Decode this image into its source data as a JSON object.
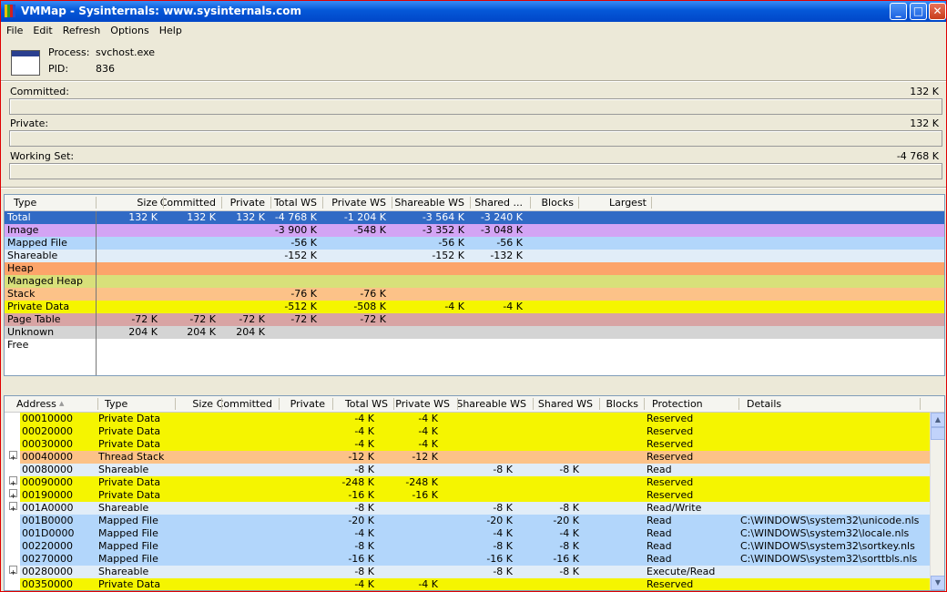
{
  "window": {
    "title": "VMMap - Sysinternals: www.sysinternals.com"
  },
  "icons": {
    "app": "vmmap-app-icon",
    "minimize": "minimize-icon",
    "maximize": "maximize-icon",
    "close": "close-icon",
    "process": "process-window-icon",
    "expand": "plus-expand-icon",
    "sort": "sort-ascending-icon"
  },
  "menu": [
    "File",
    "Edit",
    "Refresh",
    "Options",
    "Help"
  ],
  "process": {
    "process_label": "Process:",
    "process_value": "svchost.exe",
    "pid_label": "PID:",
    "pid_value": "836"
  },
  "meters": {
    "committed": {
      "label": "Committed:",
      "value": "132 K"
    },
    "private": {
      "label": "Private:",
      "value": "132 K"
    },
    "working_set": {
      "label": "Working Set:",
      "value": "-4 768 K"
    }
  },
  "summary": {
    "columns": [
      "Type",
      "Size",
      "Committed",
      "Private",
      "Total WS",
      "Private WS",
      "Shareable WS",
      "Shared ...",
      "Blocks",
      "Largest"
    ],
    "rows": [
      {
        "type": "Total",
        "size": "132 K",
        "committed": "132 K",
        "private": "132 K",
        "total_ws": "-4 768 K",
        "private_ws": "-1 204 K",
        "shareable_ws": "-3 564 K",
        "shared": "-3 240 K",
        "color": "#316ac5"
      },
      {
        "type": "Image",
        "size": "",
        "committed": "",
        "private": "",
        "total_ws": "-3 900 K",
        "private_ws": "-548 K",
        "shareable_ws": "-3 352 K",
        "shared": "-3 048 K",
        "color": "#d3a4f4"
      },
      {
        "type": "Mapped File",
        "size": "",
        "committed": "",
        "private": "",
        "total_ws": "-56 K",
        "private_ws": "",
        "shareable_ws": "-56 K",
        "shared": "-56 K",
        "color": "#b2d6fb"
      },
      {
        "type": "Shareable",
        "size": "",
        "committed": "",
        "private": "",
        "total_ws": "-152 K",
        "private_ws": "",
        "shareable_ws": "-152 K",
        "shared": "-132 K",
        "color": "#e1edf8"
      },
      {
        "type": "Heap",
        "size": "",
        "committed": "",
        "private": "",
        "total_ws": "",
        "private_ws": "",
        "shareable_ws": "",
        "shared": "",
        "color": "#fca46a"
      },
      {
        "type": "Managed Heap",
        "size": "",
        "committed": "",
        "private": "",
        "total_ws": "",
        "private_ws": "",
        "shareable_ws": "",
        "shared": "",
        "color": "#d8e07a"
      },
      {
        "type": "Stack",
        "size": "",
        "committed": "",
        "private": "",
        "total_ws": "-76 K",
        "private_ws": "-76 K",
        "shareable_ws": "",
        "shared": "",
        "color": "#fcc288"
      },
      {
        "type": "Private Data",
        "size": "",
        "committed": "",
        "private": "",
        "total_ws": "-512 K",
        "private_ws": "-508 K",
        "shareable_ws": "-4 K",
        "shared": "-4 K",
        "color": "#f5f500"
      },
      {
        "type": "Page Table",
        "size": "-72 K",
        "committed": "-72 K",
        "private": "-72 K",
        "total_ws": "-72 K",
        "private_ws": "-72 K",
        "shareable_ws": "",
        "shared": "",
        "color": "#d8a4a4"
      },
      {
        "type": "Unknown",
        "size": "204 K",
        "committed": "204 K",
        "private": "204 K",
        "total_ws": "",
        "private_ws": "",
        "shareable_ws": "",
        "shared": "",
        "color": "#d4d4d4"
      },
      {
        "type": "Free",
        "size": "",
        "committed": "",
        "private": "",
        "total_ws": "",
        "private_ws": "",
        "shareable_ws": "",
        "shared": "",
        "color": "#ffffff"
      }
    ]
  },
  "details": {
    "columns": [
      "Address",
      "Type",
      "Size",
      "Committed",
      "Private",
      "Total WS",
      "Private WS",
      "Shareable WS",
      "Shared WS",
      "Blocks",
      "Protection",
      "Details"
    ],
    "rows": [
      {
        "expand": false,
        "address": "00010000",
        "type": "Private Data",
        "total_ws": "-4 K",
        "private_ws": "-4 K",
        "shareable_ws": "",
        "shared_ws": "",
        "protection": "Reserved",
        "details": "",
        "color": "#f5f500"
      },
      {
        "expand": false,
        "address": "00020000",
        "type": "Private Data",
        "total_ws": "-4 K",
        "private_ws": "-4 K",
        "shareable_ws": "",
        "shared_ws": "",
        "protection": "Reserved",
        "details": "",
        "color": "#f5f500"
      },
      {
        "expand": false,
        "address": "00030000",
        "type": "Private Data",
        "total_ws": "-4 K",
        "private_ws": "-4 K",
        "shareable_ws": "",
        "shared_ws": "",
        "protection": "Reserved",
        "details": "",
        "color": "#f5f500"
      },
      {
        "expand": true,
        "address": "00040000",
        "type": "Thread Stack",
        "total_ws": "-12 K",
        "private_ws": "-12 K",
        "shareable_ws": "",
        "shared_ws": "",
        "protection": "Reserved",
        "details": "",
        "color": "#fcc288"
      },
      {
        "expand": false,
        "address": "00080000",
        "type": "Shareable",
        "total_ws": "-8 K",
        "private_ws": "",
        "shareable_ws": "-8 K",
        "shared_ws": "-8 K",
        "protection": "Read",
        "details": "",
        "color": "#e1edf8"
      },
      {
        "expand": true,
        "address": "00090000",
        "type": "Private Data",
        "total_ws": "-248 K",
        "private_ws": "-248 K",
        "shareable_ws": "",
        "shared_ws": "",
        "protection": "Reserved",
        "details": "",
        "color": "#f5f500"
      },
      {
        "expand": true,
        "address": "00190000",
        "type": "Private Data",
        "total_ws": "-16 K",
        "private_ws": "-16 K",
        "shareable_ws": "",
        "shared_ws": "",
        "protection": "Reserved",
        "details": "",
        "color": "#f5f500"
      },
      {
        "expand": true,
        "address": "001A0000",
        "type": "Shareable",
        "total_ws": "-8 K",
        "private_ws": "",
        "shareable_ws": "-8 K",
        "shared_ws": "-8 K",
        "protection": "Read/Write",
        "details": "",
        "color": "#e1edf8"
      },
      {
        "expand": false,
        "address": "001B0000",
        "type": "Mapped File",
        "total_ws": "-20 K",
        "private_ws": "",
        "shareable_ws": "-20 K",
        "shared_ws": "-20 K",
        "protection": "Read",
        "details": "C:\\WINDOWS\\system32\\unicode.nls",
        "color": "#b2d6fb"
      },
      {
        "expand": false,
        "address": "001D0000",
        "type": "Mapped File",
        "total_ws": "-4 K",
        "private_ws": "",
        "shareable_ws": "-4 K",
        "shared_ws": "-4 K",
        "protection": "Read",
        "details": "C:\\WINDOWS\\system32\\locale.nls",
        "color": "#b2d6fb"
      },
      {
        "expand": false,
        "address": "00220000",
        "type": "Mapped File",
        "total_ws": "-8 K",
        "private_ws": "",
        "shareable_ws": "-8 K",
        "shared_ws": "-8 K",
        "protection": "Read",
        "details": "C:\\WINDOWS\\system32\\sortkey.nls",
        "color": "#b2d6fb"
      },
      {
        "expand": false,
        "address": "00270000",
        "type": "Mapped File",
        "total_ws": "-16 K",
        "private_ws": "",
        "shareable_ws": "-16 K",
        "shared_ws": "-16 K",
        "protection": "Read",
        "details": "C:\\WINDOWS\\system32\\sorttbls.nls",
        "color": "#b2d6fb"
      },
      {
        "expand": true,
        "address": "00280000",
        "type": "Shareable",
        "total_ws": "-8 K",
        "private_ws": "",
        "shareable_ws": "-8 K",
        "shared_ws": "-8 K",
        "protection": "Execute/Read",
        "details": "",
        "color": "#e1edf8"
      },
      {
        "expand": false,
        "address": "00350000",
        "type": "Private Data",
        "total_ws": "-4 K",
        "private_ws": "-4 K",
        "shareable_ws": "",
        "shared_ws": "",
        "protection": "Reserved",
        "details": "",
        "color": "#f5f500"
      }
    ]
  }
}
